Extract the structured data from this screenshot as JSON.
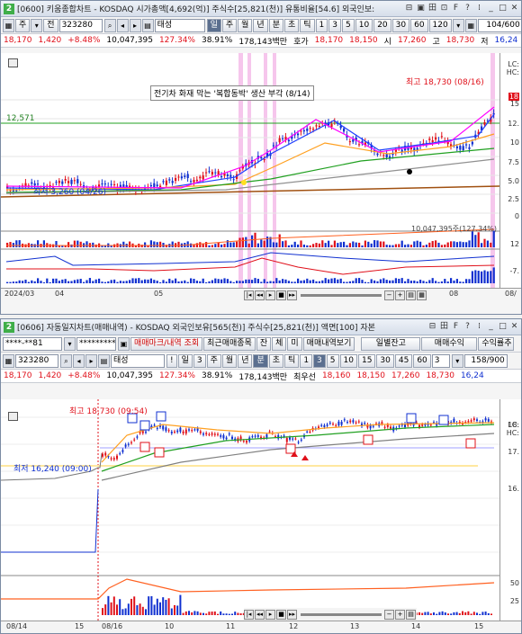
{
  "top": {
    "num": "2",
    "title": "[0600] 키움종합차트 - KOSDAQ 시가총액[4,692(억)] 주식수[25,821(천)] 유통비율[54.6] 외국인보:",
    "toolbar": {
      "mode": "주",
      "jeon": "전",
      "code": "323280",
      "name": "태성",
      "periods": [
        "일",
        "주",
        "월",
        "년",
        "분",
        "초",
        "틱"
      ],
      "mins": [
        "1",
        "3",
        "5",
        "10",
        "20",
        "30",
        "60",
        "120"
      ],
      "count": "104/600"
    },
    "quote": {
      "price": "18,170",
      "change": "1,420",
      "rate": "+8.48%",
      "vol": "10,047,395",
      "pct1": "127.34%",
      "pct2": "38.91%",
      "amount": "178,143백만",
      "hoga_label": "호가",
      "ask": "18,170",
      "bid": "18,150",
      "open_label": "시",
      "open": "17,260",
      "high_label": "고",
      "high": "18,730",
      "low_label": "저",
      "low": "16,24"
    },
    "news": "전기차 화재 막는 '복합동박' 생산 부각 (8/14)",
    "hi_label": "최고 18,730 (08/16)",
    "lo_label": "최저 3,260 (04/26)",
    "level_label": "12,571",
    "vol_label": "10,047,395주(127.34%)",
    "axis_price": [
      "15",
      "12.",
      "10",
      "7.5",
      "5.0",
      "2.5",
      "0"
    ],
    "axis_osc": [
      "12",
      "-7."
    ],
    "xaxis": [
      "2024/03",
      "04",
      "05",
      "06",
      "07",
      "08",
      "08/"
    ],
    "right_tags": [
      "LC:",
      "HC:"
    ],
    "colors": {
      "up": "#e0101a",
      "down": "#1030d0",
      "ma5": "#ff00ff",
      "ma20": "#2040ff",
      "ma60": "#ffa020",
      "ma120": "#20a020"
    }
  },
  "bottom": {
    "num": "2",
    "title": "[0606] 자동일지차트(매매내역) - KOSDAQ 외국인보유[565(천)] 주식수[25,821(천)] 액면[100] 자본",
    "tb1": {
      "account": "****-**81",
      "password": "*********",
      "tab1": "매매마크/내역 조회",
      "tab2": "최근매매종목",
      "b1": "잔",
      "b2": "체",
      "b3": "미",
      "b4": "매매내역보기",
      "b5": "일별잔고",
      "b6": "매매수익",
      "b7": "수익률추"
    },
    "tb2": {
      "code": "323280",
      "name": "태성",
      "bang": "!",
      "periods": [
        "일",
        "3",
        "주",
        "월",
        "년",
        "분",
        "초",
        "틱"
      ],
      "mins": [
        "1",
        "3",
        "5",
        "10",
        "15",
        "30",
        "45",
        "60"
      ],
      "sel": "3",
      "count": "158/900"
    },
    "quote": {
      "price": "18,170",
      "change": "1,420",
      "rate": "+8.48%",
      "vol": "10,047,395",
      "pct1": "127.34%",
      "pct2": "38.91%",
      "amount": "178,143백만",
      "hoga_label": "최우선",
      "ask": "18,160",
      "bid": "18,150",
      "open": "17,260",
      "high": "18,730",
      "low": "16,24"
    },
    "hi_label": "최고 18,730 (09:54)",
    "lo_label": "최저 16,240 (09:00)",
    "axis_price": [
      "18.",
      "17.",
      "16."
    ],
    "axis_osc": [
      "50",
      "25"
    ],
    "xaxis": [
      "08/14",
      "15",
      "08/16",
      "10",
      "11",
      "12",
      "13",
      "14",
      "15"
    ],
    "right_tags": [
      "LC:",
      "HC:"
    ]
  }
}
